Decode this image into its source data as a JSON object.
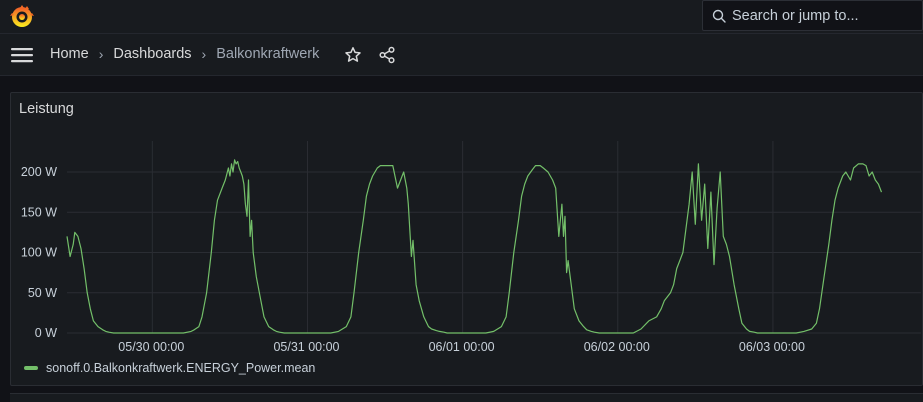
{
  "app": {
    "logo_icon": "grafana-logo-icon"
  },
  "search": {
    "placeholder": "Search or jump to..."
  },
  "breadcrumbs": [
    {
      "label": "Home"
    },
    {
      "label": "Dashboards"
    },
    {
      "label": "Balkonkraftwerk"
    }
  ],
  "icons": {
    "menu": "hamburger-icon",
    "star": "star-icon",
    "share": "share-icon"
  },
  "colors": {
    "series": "#73bf69",
    "background": "#111217",
    "panel": "#181b1f"
  },
  "panel": {
    "title": "Leistung"
  },
  "chart_data": {
    "type": "line",
    "title": "Leistung",
    "xlabel": "",
    "ylabel": "",
    "y_ticks": [
      "0 W",
      "50 W",
      "100 W",
      "150 W",
      "200 W"
    ],
    "ylim": [
      0,
      220
    ],
    "x_ticks": [
      "05/30 00:00",
      "05/31 00:00",
      "06/01 00:00",
      "06/02 00:00",
      "06/03 00:00"
    ],
    "x_tick_days": [
      1,
      2,
      3,
      4,
      5
    ],
    "xlim_days": [
      0.45,
      5.89
    ],
    "grid": true,
    "legend": "bottom-left",
    "series": [
      {
        "name": "sonoff.0.Balkonkraftwerk.ENERGY_Power.mean",
        "color": "#73bf69",
        "days": [
          0.45,
          0.47,
          0.49,
          0.5,
          0.52,
          0.54,
          0.56,
          0.58,
          0.6,
          0.62,
          0.65,
          0.68,
          0.7,
          0.72,
          0.75,
          0.8,
          0.85,
          0.9,
          0.95,
          1.0,
          1.05,
          1.1,
          1.15,
          1.2,
          1.25,
          1.27,
          1.3,
          1.32,
          1.35,
          1.38,
          1.4,
          1.42,
          1.45,
          1.47,
          1.49,
          1.5,
          1.51,
          1.52,
          1.53,
          1.54,
          1.55,
          1.56,
          1.57,
          1.58,
          1.59,
          1.6,
          1.61,
          1.62,
          1.63,
          1.64,
          1.65,
          1.67,
          1.7,
          1.72,
          1.75,
          1.78,
          1.8,
          1.82,
          1.85,
          1.9,
          1.95,
          2.0,
          2.05,
          2.1,
          2.15,
          2.2,
          2.25,
          2.28,
          2.3,
          2.33,
          2.36,
          2.38,
          2.4,
          2.42,
          2.45,
          2.47,
          2.5,
          2.52,
          2.55,
          2.58,
          2.6,
          2.62,
          2.64,
          2.65,
          2.67,
          2.68,
          2.7,
          2.72,
          2.75,
          2.78,
          2.8,
          2.83,
          2.85,
          2.88,
          2.9,
          2.95,
          3.0,
          3.05,
          3.1,
          3.15,
          3.2,
          3.25,
          3.28,
          3.3,
          3.33,
          3.36,
          3.38,
          3.4,
          3.42,
          3.45,
          3.47,
          3.5,
          3.52,
          3.55,
          3.58,
          3.6,
          3.62,
          3.64,
          3.65,
          3.66,
          3.67,
          3.68,
          3.7,
          3.72,
          3.75,
          3.78,
          3.8,
          3.83,
          3.85,
          3.88,
          3.9,
          3.95,
          4.0,
          4.05,
          4.1,
          4.15,
          4.2,
          4.25,
          4.28,
          4.3,
          4.32,
          4.34,
          4.36,
          4.38,
          4.4,
          4.42,
          4.44,
          4.46,
          4.48,
          4.5,
          4.52,
          4.54,
          4.56,
          4.58,
          4.6,
          4.62,
          4.64,
          4.66,
          4.68,
          4.7,
          4.72,
          4.75,
          4.78,
          4.8,
          4.83,
          4.85,
          4.88,
          4.9,
          4.95,
          5.0,
          5.05,
          5.1,
          5.15,
          5.2,
          5.25,
          5.28,
          5.3,
          5.33,
          5.36,
          5.38,
          5.4,
          5.42,
          5.45,
          5.47,
          5.5,
          5.52,
          5.55,
          5.58,
          5.6,
          5.62,
          5.64,
          5.66,
          5.68,
          5.7,
          5.72,
          5.75,
          5.78,
          5.8,
          5.82,
          5.85,
          5.87,
          5.89
        ],
        "values": [
          120,
          95,
          110,
          125,
          120,
          105,
          80,
          50,
          30,
          15,
          8,
          4,
          2,
          1,
          0,
          0,
          0,
          0,
          0,
          0,
          0,
          0,
          0,
          0,
          2,
          4,
          8,
          20,
          50,
          100,
          140,
          165,
          180,
          190,
          205,
          195,
          210,
          200,
          215,
          210,
          213,
          205,
          200,
          195,
          185,
          160,
          145,
          190,
          120,
          140,
          100,
          70,
          40,
          20,
          8,
          4,
          2,
          1,
          0,
          0,
          0,
          0,
          0,
          0,
          0,
          2,
          8,
          20,
          50,
          100,
          140,
          170,
          185,
          195,
          205,
          208,
          208,
          208,
          208,
          180,
          190,
          200,
          180,
          160,
          95,
          115,
          60,
          40,
          20,
          8,
          5,
          3,
          2,
          1,
          0,
          0,
          0,
          0,
          0,
          0,
          2,
          8,
          20,
          50,
          100,
          140,
          170,
          185,
          195,
          203,
          208,
          208,
          205,
          200,
          190,
          180,
          120,
          160,
          120,
          145,
          75,
          90,
          60,
          30,
          15,
          8,
          4,
          2,
          1,
          0,
          0,
          0,
          0,
          0,
          0,
          5,
          15,
          20,
          30,
          40,
          45,
          50,
          60,
          80,
          90,
          100,
          130,
          160,
          200,
          135,
          210,
          140,
          185,
          105,
          175,
          85,
          155,
          200,
          120,
          110,
          95,
          60,
          30,
          12,
          5,
          2,
          1,
          0,
          0,
          0,
          0,
          0,
          0,
          2,
          5,
          12,
          30,
          70,
          110,
          140,
          165,
          180,
          195,
          200,
          190,
          205,
          210,
          210,
          208,
          195,
          200,
          190,
          185,
          175
        ]
      }
    ]
  }
}
